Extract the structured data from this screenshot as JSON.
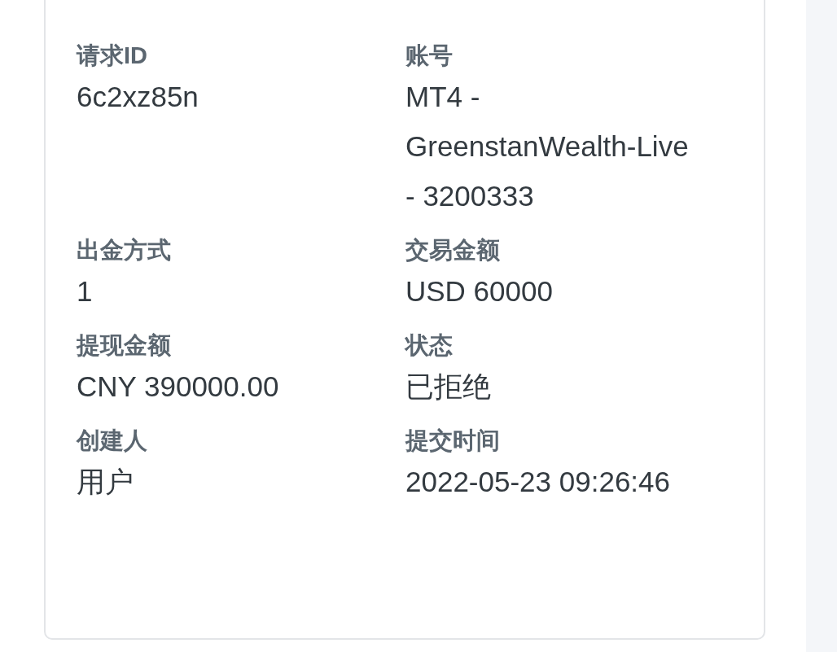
{
  "fields": [
    {
      "label": "请求ID",
      "value": "6c2xz85n"
    },
    {
      "label": "账号",
      "value": "MT4 - GreenstanWealth-Live - 3200333"
    },
    {
      "label": "出金方式",
      "value": "1"
    },
    {
      "label": "交易金额",
      "value": "USD 60000"
    },
    {
      "label": "提现金额",
      "value": "CNY 390000.00"
    },
    {
      "label": "状态",
      "value": "已拒绝"
    },
    {
      "label": "创建人",
      "value": "用户"
    },
    {
      "label": "提交时间",
      "value": "2022-05-23 09:26:46"
    }
  ]
}
